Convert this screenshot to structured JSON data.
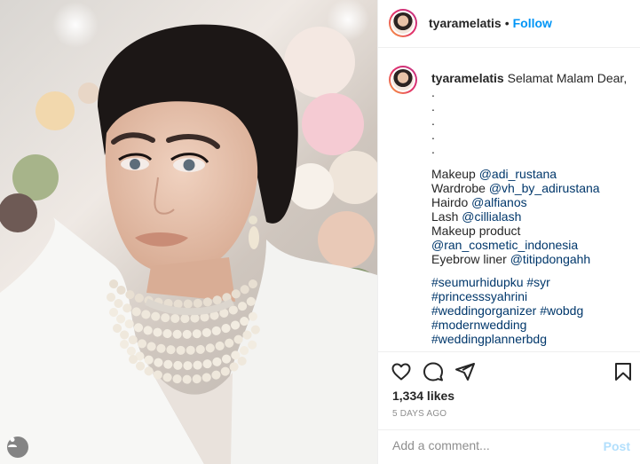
{
  "post": {
    "username": "tyaramelatis",
    "follow_label": "Follow",
    "separator": "•"
  },
  "caption": {
    "username": "tyaramelatis",
    "greeting": "Selamat Malam Dear,",
    "dots": [
      ".",
      ".",
      ".",
      ".",
      "."
    ],
    "credits": [
      {
        "label": "Makeup",
        "handle": "@adi_rustana"
      },
      {
        "label": "Wardrobe",
        "handle": "@vh_by_adirustana"
      },
      {
        "label": "Hairdo",
        "handle": "@alfianos"
      },
      {
        "label": "Lash",
        "handle": "@cillialash"
      },
      {
        "label": "Makeup product",
        "handle": ""
      },
      {
        "label": "",
        "handle": "@ran_cosmetic_indonesia"
      },
      {
        "label": "Eyebrow liner",
        "handle": "@titipdongahh"
      }
    ],
    "hashtag_lines": [
      "#seumurhidupku #syr",
      "#princesssyahrini",
      "#weddingorganizer #wobdg",
      "#modernwedding",
      "#weddingplannerbdg"
    ]
  },
  "actions": {
    "like_icon": "heart-icon",
    "comment_icon": "comment-icon",
    "share_icon": "share-icon",
    "save_icon": "bookmark-icon"
  },
  "likes_text": "1,334 likes",
  "date_text": "5 DAYS AGO",
  "comment": {
    "placeholder": "Add a comment...",
    "post_label": "Post"
  },
  "colors": {
    "accent": "#0095f6",
    "link": "#00376b",
    "muted": "#8e8e8e",
    "post_disabled": "#b2dffc"
  }
}
